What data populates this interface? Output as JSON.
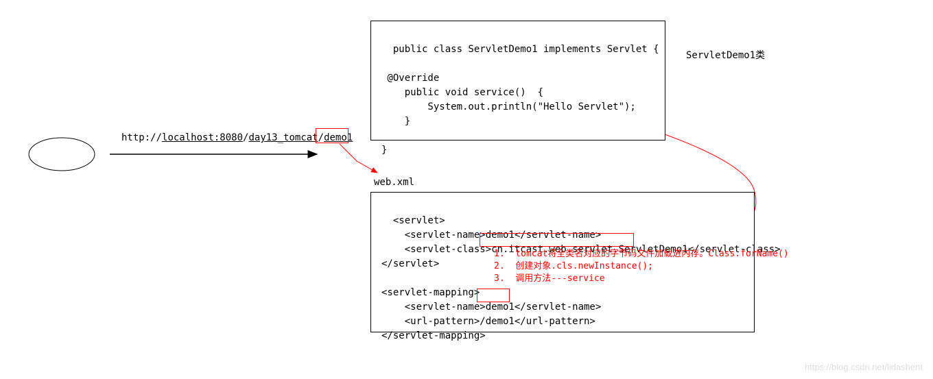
{
  "url": {
    "prefix": "http://",
    "host": "localhost:8080",
    "sep1": "/",
    "path1": "day13_tomcat",
    "sep2": "/",
    "path2": "demo1"
  },
  "topCode": "public class ServletDemo1 implements Servlet {\n\n @Override\n    public void service()  {\n        System.out.println(\"Hello Servlet\");\n    }\n\n}",
  "classLabel": "ServletDemo1类",
  "webxmlLabel": "web.xml",
  "bottomCode": "<servlet>\n    <servlet-name>demo1</servlet-name>\n    <servlet-class>cn.itcast.web.servlet.ServletDemo1</servlet-class>\n</servlet>\n\n<servlet-mapping>\n    <servlet-name>demo1</servlet-name>\n    <url-pattern>/demo1</url-pattern>\n</servlet-mapping>",
  "redNotes": "1.  tomcat将全类名对应的字节码文件加载进内存。Class.forName()\n2.  创建对象.cls.newInstance();\n3.  调用方法---service",
  "watermark": "https://blog.csdn.net/lidashent"
}
